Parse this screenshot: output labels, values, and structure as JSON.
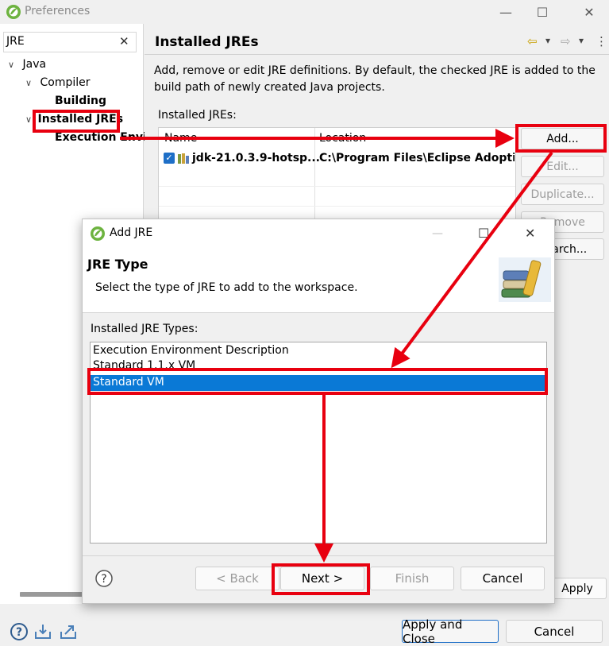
{
  "window": {
    "title": "Preferences",
    "minimize_glyph": "—",
    "maximize_glyph": "☐",
    "close_glyph": "✕"
  },
  "filter": {
    "value": "JRE",
    "clear_glyph": "✕"
  },
  "tree": {
    "items": [
      {
        "label": "Java",
        "twisty": "∨"
      },
      {
        "label": "Compiler",
        "twisty": "∨"
      },
      {
        "label": "Building"
      },
      {
        "label": "Installed JREs",
        "twisty": "∨"
      },
      {
        "label": "Execution Envi"
      }
    ]
  },
  "page": {
    "title": "Installed JREs",
    "description": "Add, remove or edit JRE definitions. By default, the checked JRE is added to the build path of newly created Java projects.",
    "installed_label": "Installed JREs:",
    "columns": [
      "Name",
      "Location"
    ],
    "rows": [
      {
        "name": "jdk-21.0.3.9-hotsp...",
        "location": "C:\\Program Files\\Eclipse Adoptium",
        "checked": true
      }
    ],
    "buttons": {
      "add": "Add...",
      "edit": "Edit...",
      "duplicate": "Duplicate...",
      "remove": "Remove",
      "search": "Search..."
    },
    "apply": "Apply",
    "nav_back_glyph": "⇦",
    "nav_forward_glyph": "⇨",
    "dropdown_glyph": "▾",
    "menu_glyph": "⋮"
  },
  "footer": {
    "apply_and_close": "Apply and Close",
    "cancel": "Cancel"
  },
  "dialog": {
    "title": "Add JRE",
    "heading": "JRE Type",
    "subtitle": "Select the type of JRE to add to the workspace.",
    "types_label": "Installed JRE Types:",
    "types": [
      "Execution Environment Description",
      "Standard 1.1.x VM",
      "Standard VM"
    ],
    "selected_index": 2,
    "buttons": {
      "back": "< Back",
      "next": "Next >",
      "finish": "Finish",
      "cancel": "Cancel"
    },
    "help_glyph": "?"
  },
  "colors": {
    "annotation_red": "#e8000f",
    "selection_blue": "#0a79d6",
    "focus_blue": "#1e6fc7"
  }
}
